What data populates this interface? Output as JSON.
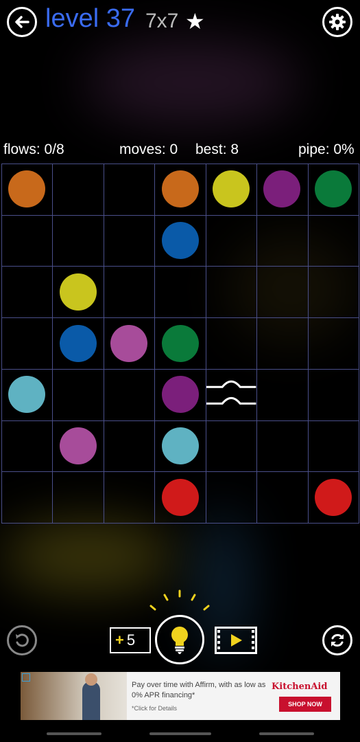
{
  "header": {
    "title": "level 37",
    "size": "7x7",
    "star": "★"
  },
  "stats": {
    "flows": "flows: 0/8",
    "moves": "moves: 0",
    "best": "best: 8",
    "pipe": "pipe: 0%"
  },
  "board": {
    "rows": 7,
    "cols": 7,
    "colors": {
      "orange": "#c8691b",
      "yellow": "#c9c51e",
      "purple": "#7b1f7b",
      "green": "#0a7a3a",
      "blue": "#0a5aa8",
      "pink": "#a74c9a",
      "cyan": "#5fb2c2",
      "red": "#d01a1a"
    },
    "dots": [
      {
        "row": 0,
        "col": 0,
        "color": "orange"
      },
      {
        "row": 0,
        "col": 3,
        "color": "orange"
      },
      {
        "row": 0,
        "col": 4,
        "color": "yellow"
      },
      {
        "row": 0,
        "col": 5,
        "color": "purple"
      },
      {
        "row": 0,
        "col": 6,
        "color": "green"
      },
      {
        "row": 1,
        "col": 3,
        "color": "blue"
      },
      {
        "row": 2,
        "col": 1,
        "color": "yellow"
      },
      {
        "row": 3,
        "col": 1,
        "color": "blue"
      },
      {
        "row": 3,
        "col": 2,
        "color": "pink"
      },
      {
        "row": 3,
        "col": 3,
        "color": "green"
      },
      {
        "row": 4,
        "col": 0,
        "color": "cyan"
      },
      {
        "row": 4,
        "col": 3,
        "color": "purple"
      },
      {
        "row": 5,
        "col": 1,
        "color": "pink"
      },
      {
        "row": 5,
        "col": 3,
        "color": "cyan"
      },
      {
        "row": 6,
        "col": 3,
        "color": "red"
      },
      {
        "row": 6,
        "col": 6,
        "color": "red"
      }
    ],
    "bridge": {
      "row": 4,
      "col": 4
    }
  },
  "controls": {
    "hint_plus": "+",
    "hint_count": "5"
  },
  "ad": {
    "text": "Pay over time with Affirm, with as low as 0% APR financing*",
    "small": "*Click for Details",
    "brand": "KitchenAid",
    "cta": "SHOP NOW"
  },
  "icons": {
    "back": "back-arrow-icon",
    "settings": "gear-icon",
    "undo": "undo-icon",
    "hint": "lightbulb-icon",
    "video": "video-play-icon",
    "restart": "restart-icon"
  }
}
